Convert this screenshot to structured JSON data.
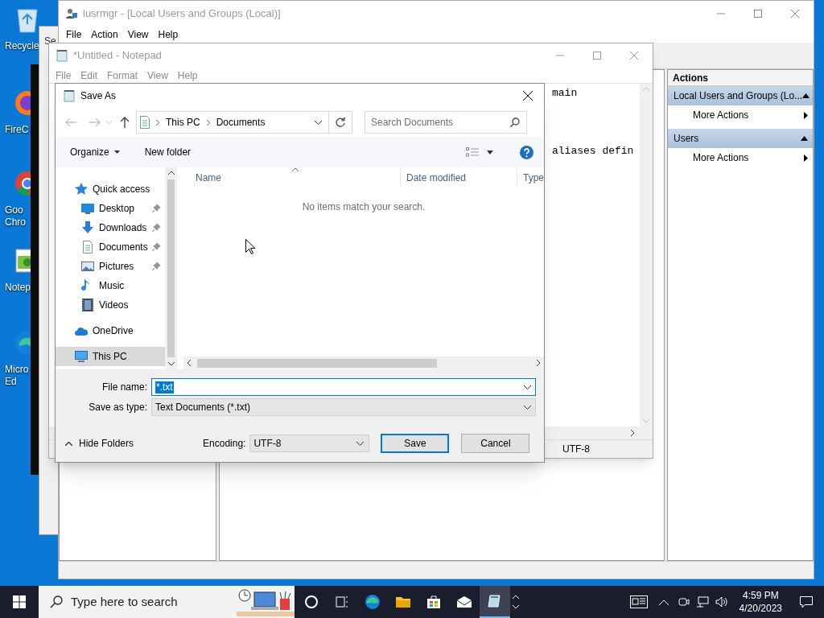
{
  "desktop_icons": [
    {
      "lines": [
        "Recycle"
      ]
    },
    {
      "lines": [
        "FireC"
      ]
    },
    {
      "lines": [
        "Goo",
        "Chro"
      ]
    },
    {
      "lines": [
        "Notep"
      ]
    },
    {
      "lines": [
        "Micro",
        "Ed"
      ]
    }
  ],
  "background_window": {
    "title": "Se"
  },
  "lusrmgr": {
    "title": "lusrmgr - [Local Users and Groups (Local)]",
    "menu": [
      "File",
      "Action",
      "View",
      "Help"
    ],
    "actions": {
      "header": "Actions",
      "sections": [
        {
          "title": "Local Users and Groups (Lo...",
          "items": [
            "More Actions"
          ]
        },
        {
          "title": "Users",
          "items": [
            "More Actions"
          ]
        }
      ]
    }
  },
  "notepad": {
    "title": "*Untitled - Notepad",
    "menu": [
      "File",
      "Edit",
      "Format",
      "View",
      "Help"
    ],
    "text_lines": [
      "main",
      "aliases defin"
    ],
    "encoding": "UTF-8"
  },
  "save_as": {
    "title": "Save As",
    "breadcrumb": [
      "This PC",
      "Documents"
    ],
    "search_placeholder": "Search Documents",
    "toolbar": [
      "Organize",
      "New folder"
    ],
    "nav": [
      {
        "label": "Quick access",
        "selected": false,
        "children": [
          {
            "label": "Desktop",
            "pinned": true,
            "selected": false
          },
          {
            "label": "Downloads",
            "pinned": true,
            "selected": false
          },
          {
            "label": "Documents",
            "pinned": true,
            "selected": false
          },
          {
            "label": "Pictures",
            "pinned": true,
            "selected": false
          },
          {
            "label": "Music",
            "pinned": false,
            "selected": false
          },
          {
            "label": "Videos",
            "pinned": false,
            "selected": false
          }
        ]
      },
      {
        "label": "OneDrive",
        "selected": false
      },
      {
        "label": "This PC",
        "selected": true
      }
    ],
    "columns": [
      "Name",
      "Date modified",
      "Type"
    ],
    "empty_message": "No items match your search.",
    "file_name_label": "File name:",
    "file_name": {
      "value": "*.txt",
      "text_selected": true
    },
    "save_type_label": "Save as type:",
    "save_type": "Text Documents (*.txt)",
    "hide_folders": "Hide Folders",
    "encoding_label": "Encoding:",
    "encoding": "UTF-8",
    "buttons": [
      "Save",
      "Cancel"
    ]
  },
  "taskbar": {
    "search_placeholder": "Type here to search",
    "apps": [
      {
        "selected": false
      },
      {
        "selected": false
      },
      {
        "selected": false
      },
      {
        "selected": false
      },
      {
        "selected": false
      },
      {
        "selected": false
      },
      {
        "selected": true
      }
    ],
    "time": "4:59 PM",
    "date": "4/20/2023"
  }
}
